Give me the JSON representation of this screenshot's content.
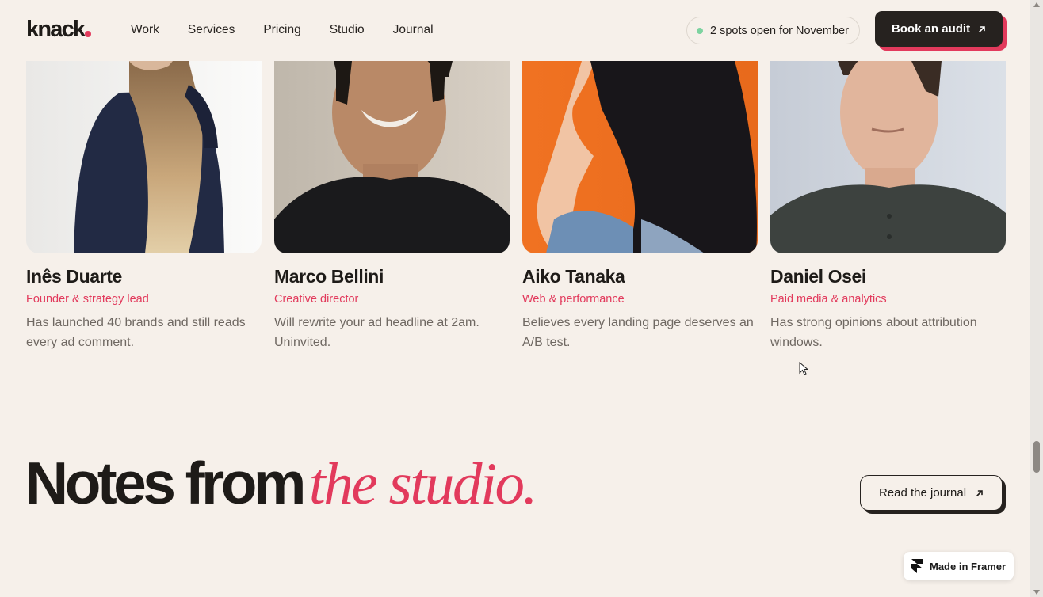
{
  "header": {
    "logo": "knack",
    "nav": [
      {
        "label": "Work"
      },
      {
        "label": "Services"
      },
      {
        "label": "Pricing"
      },
      {
        "label": "Studio"
      },
      {
        "label": "Journal"
      }
    ],
    "availability": "2 spots open for November",
    "cta_label": "Book an audit"
  },
  "team": [
    {
      "name": "Inês Duarte",
      "role": "Founder & strategy lead",
      "bio": "Has launched 40 brands and still reads every ad comment."
    },
    {
      "name": "Marco Bellini",
      "role": "Creative director",
      "bio": "Will rewrite your ad headline at 2am. Uninvited."
    },
    {
      "name": "Aiko Tanaka",
      "role": "Web & performance",
      "bio": "Believes every landing page deserves an A/B test."
    },
    {
      "name": "Daniel Osei",
      "role": "Paid media & analytics",
      "bio": "Has strong opinions about attribution windows."
    }
  ],
  "notes": {
    "title_plain": "Notes from",
    "title_accent": "the studio.",
    "button_label": "Read the journal"
  },
  "badge": {
    "label": "Made in Framer"
  },
  "colors": {
    "background": "#f6f0ea",
    "accent": "#e23a5c",
    "dark": "#26221f",
    "availability_dot": "#7dd3a0"
  }
}
